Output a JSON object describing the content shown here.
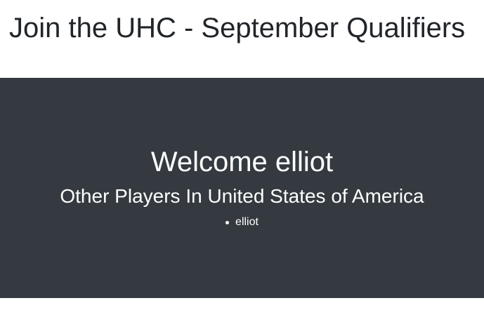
{
  "page": {
    "title": "Join the UHC - September Qualifiers"
  },
  "hero": {
    "welcome_text": "Welcome elliot",
    "subtitle": "Other Players In United States of America",
    "players": [
      "elliot"
    ]
  },
  "colors": {
    "hero_background": "#343a40",
    "title_text": "#212529",
    "hero_text": "#ffffff"
  }
}
